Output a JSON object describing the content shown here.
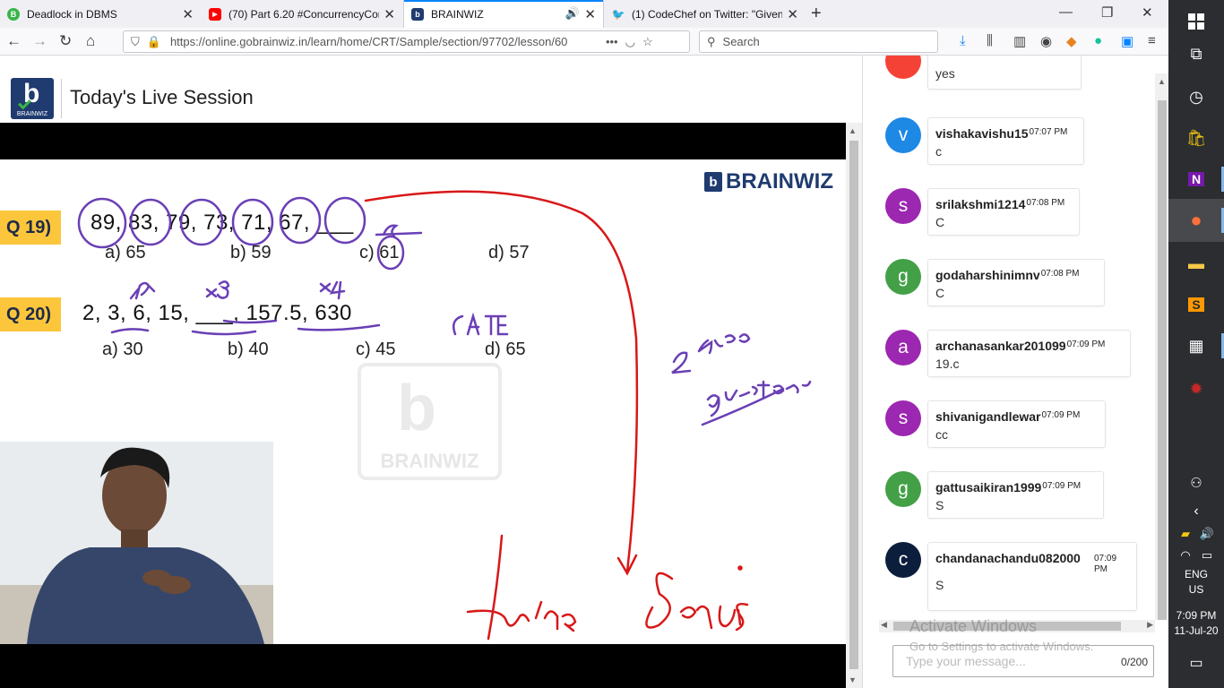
{
  "browser": {
    "tabs": [
      {
        "title": "Deadlock in DBMS",
        "icon": "B",
        "icon_color": "#39b54a"
      },
      {
        "title": "(70) Part 6.20 #ConcurrencyCon",
        "icon": "▶",
        "icon_color": "#ff0000"
      },
      {
        "title": "BRAINWIZ",
        "icon": "b",
        "icon_color": "#1f3b6f",
        "audio": "🔊"
      },
      {
        "title": "(1) CodeChef on Twitter: \"Given",
        "icon": "🐦",
        "icon_color": "#1da1f2"
      }
    ],
    "url": "https://online.gobrainwiz.in/learn/home/CRT/Sample/section/97702/lesson/60",
    "search_placeholder": "Search"
  },
  "page": {
    "logo_letter": "b",
    "logo_label": "BRAINWIZ",
    "title": "Today's Live Session"
  },
  "slide": {
    "brand": "BRAINWIZ",
    "watermark": "BRAINWIZ",
    "questions": [
      {
        "tag": "Q 19)",
        "series": "89,  83,  79,  73,  71,  67,  ___",
        "options": [
          "a) 65",
          "b) 59",
          "c) 61",
          "d) 57"
        ]
      },
      {
        "tag": "Q 20)",
        "series": "2,  3,  6,  15,  ___,  157.5,  630",
        "options": [
          "a) 30",
          "b) 40",
          "c) 45",
          "d) 65"
        ]
      }
    ]
  },
  "chat": {
    "messages": [
      {
        "user": "",
        "time": "",
        "text": "yes",
        "initial": "",
        "color": "#f44336"
      },
      {
        "user": "vishakavishu15",
        "time": "07:07 PM",
        "text": "c",
        "initial": "v",
        "color": "#1e88e5"
      },
      {
        "user": "srilakshmi1214",
        "time": "07:08 PM",
        "text": "C",
        "initial": "s",
        "color": "#9c27b0"
      },
      {
        "user": "godaharshinimnv",
        "time": "07:08 PM",
        "text": "C",
        "initial": "g",
        "color": "#43a047"
      },
      {
        "user": "archanasankar201099",
        "time": "07:09 PM",
        "text": "19.c",
        "initial": "a",
        "color": "#9c27b0"
      },
      {
        "user": "shivanigandlewar",
        "time": "07:09 PM",
        "text": "cc",
        "initial": "s",
        "color": "#9c27b0"
      },
      {
        "user": "gattusaikiran1999",
        "time": "07:09 PM",
        "text": "S",
        "initial": "g",
        "color": "#43a047"
      },
      {
        "user": "chandanachandu082000",
        "time": "07:09 PM",
        "text": "S",
        "initial": "c",
        "color": "#0b1e3b"
      }
    ],
    "input_placeholder": "Type your message...",
    "char_count": "0/200",
    "activate_title": "Activate Windows",
    "activate_sub": "Go to Settings to activate Windows."
  },
  "taskbar": {
    "language": "ENG",
    "region": "US",
    "time": "7:09 PM",
    "date": "11-Jul-20"
  }
}
